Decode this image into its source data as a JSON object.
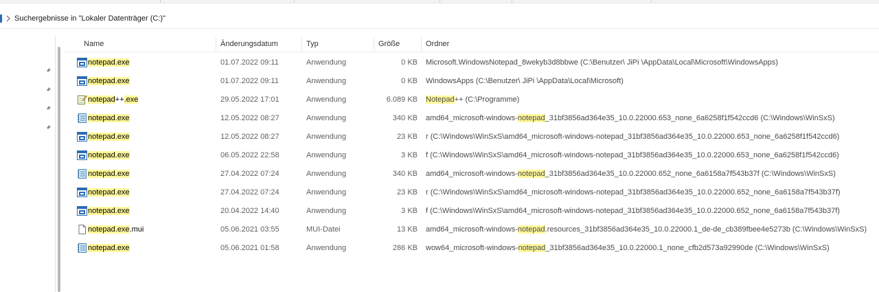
{
  "address": {
    "text": "Suchergebnisse in \"Lokaler Datenträger (C:)\""
  },
  "columns": {
    "name": "Name",
    "date": "Änderungsdatum",
    "type": "Typ",
    "size": "Größe",
    "folder": "Ordner"
  },
  "rows": [
    {
      "icon": "notepad-app-icon",
      "name_hl": "notepad.exe",
      "name_rest": "",
      "date": "01.07.2022 09:11",
      "type": "Anwendung",
      "size": "0 KB",
      "folder_pre": "Microsoft.WindowsNotepad_8wekyb3d8bbwe (C:\\Benutzer\\ JiPi \\AppData\\Local\\Microsoft\\WindowsApps)",
      "folder_hl": "",
      "folder_post": ""
    },
    {
      "icon": "notepad-app-icon",
      "name_hl": "notepad.exe",
      "name_rest": "",
      "date": "01.07.2022 09:11",
      "type": "Anwendung",
      "size": "0 KB",
      "folder_pre": "WindowsApps (C:\\Benutzer\\ JiPi \\AppData\\Local\\Microsoft)",
      "folder_hl": "",
      "folder_post": ""
    },
    {
      "icon": "notepad-plus-plus-icon",
      "name_hl": "notepad",
      "name_rest": "++",
      "name_hl2": ".exe",
      "date": "29.05.2022 17:01",
      "type": "Anwendung",
      "size": "6.089 KB",
      "folder_pre": "",
      "folder_hl": "Notepad",
      "folder_post": "++ (C:\\Programme)"
    },
    {
      "icon": "notepad-document-icon",
      "name_hl": "notepad.exe",
      "name_rest": "",
      "date": "12.05.2022 08:27",
      "type": "Anwendung",
      "size": "340 KB",
      "folder_pre": "amd64_microsoft-windows-",
      "folder_hl": "notepad",
      "folder_post": "_31bf3856ad364e35_10.0.22000.653_none_6a6258f1f542ccd6 (C:\\Windows\\WinSxS)"
    },
    {
      "icon": "notepad-app-icon",
      "name_hl": "notepad.exe",
      "name_rest": "",
      "date": "12.05.2022 08:27",
      "type": "Anwendung",
      "size": "23 KB",
      "folder_pre": "r (C:\\Windows\\WinSxS\\amd64_microsoft-windows-notepad_31bf3856ad364e35_10.0.22000.653_none_6a6258f1f542ccd6)",
      "folder_hl": "",
      "folder_post": ""
    },
    {
      "icon": "notepad-app-icon",
      "name_hl": "notepad.exe",
      "name_rest": "",
      "date": "06.05.2022 22:58",
      "type": "Anwendung",
      "size": "3 KB",
      "folder_pre": "f (C:\\Windows\\WinSxS\\amd64_microsoft-windows-notepad_31bf3856ad364e35_10.0.22000.653_none_6a6258f1f542ccd6)",
      "folder_hl": "",
      "folder_post": ""
    },
    {
      "icon": "notepad-document-icon",
      "name_hl": "notepad.exe",
      "name_rest": "",
      "date": "27.04.2022 07:24",
      "type": "Anwendung",
      "size": "340 KB",
      "folder_pre": "amd64_microsoft-windows-",
      "folder_hl": "notepad",
      "folder_post": "_31bf3856ad364e35_10.0.22000.652_none_6a6158a7f543b37f (C:\\Windows\\WinSxS)"
    },
    {
      "icon": "notepad-app-icon",
      "name_hl": "notepad.exe",
      "name_rest": "",
      "date": "27.04.2022 07:24",
      "type": "Anwendung",
      "size": "23 KB",
      "folder_pre": "r (C:\\Windows\\WinSxS\\amd64_microsoft-windows-notepad_31bf3856ad364e35_10.0.22000.652_none_6a6158a7f543b37f)",
      "folder_hl": "",
      "folder_post": ""
    },
    {
      "icon": "notepad-app-icon",
      "name_hl": "notepad.exe",
      "name_rest": "",
      "date": "20.04.2022 14:40",
      "type": "Anwendung",
      "size": "3 KB",
      "folder_pre": "f (C:\\Windows\\WinSxS\\amd64_microsoft-windows-notepad_31bf3856ad364e35_10.0.22000.652_none_6a6158a7f543b37f)",
      "folder_hl": "",
      "folder_post": ""
    },
    {
      "icon": "file-icon",
      "name_hl": "notepad.exe",
      "name_rest": ".mui",
      "date": "05.06.2021 03:55",
      "type": "MUI-Datei",
      "size": "13 KB",
      "folder_pre": "amd64_microsoft-windows-",
      "folder_hl": "notepad",
      "folder_post": ".resources_31bf3856ad364e35_10.0.22000.1_de-de_cb389fbee4e5273b (C:\\Windows\\WinSxS)"
    },
    {
      "icon": "notepad-document-icon",
      "name_hl": "notepad.exe",
      "name_rest": "",
      "date": "05.06.2021 01:58",
      "type": "Anwendung",
      "size": "286 KB",
      "folder_pre": "wow64_microsoft-windows-",
      "folder_hl": "notepad",
      "folder_post": "_31bf3856ad364e35_10.0.22000.1_none_cfb2d573a92990de (C:\\Windows\\WinSxS)"
    }
  ],
  "colors": {
    "highlight": "#fff79a",
    "accent": "#2b6cb0"
  }
}
